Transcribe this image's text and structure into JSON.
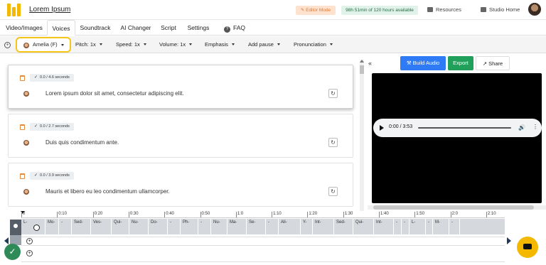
{
  "app": {
    "title": "Lorem Ipsum",
    "editor_mode": "Editor Mode",
    "time_available": "98h 51min of 120 hours available",
    "resources": "Resources",
    "studio_home": "Studio Home"
  },
  "tabs": [
    {
      "label": "Video/Images"
    },
    {
      "label": "Voices"
    },
    {
      "label": "Soundtrack"
    },
    {
      "label": "AI Changer"
    },
    {
      "label": "Script"
    },
    {
      "label": "Settings"
    },
    {
      "label": "FAQ"
    }
  ],
  "toolbar": {
    "voice": "Amelia (F)",
    "pitch": "Pitch: 1x",
    "speed": "Speed: 1x",
    "volume": "Volume: 1x",
    "emphasis": "Emphasis",
    "add_pause": "Add pause",
    "pronunciation": "Pronunciation"
  },
  "cards": [
    {
      "duration": "0.0 / 4.6 seconds",
      "text": "Lorem ipsum dolor sit amet, consectetur adipiscing elit."
    },
    {
      "duration": "0.0 / 2.7 seconds",
      "text": "Duis quis condimentum ante."
    },
    {
      "duration": "0.0 / 3.9 seconds",
      "text": "Mauris et libero eu leo condimentum ullamcorper."
    }
  ],
  "right": {
    "collapse": "«",
    "build_audio": "Build Audio",
    "export": "Export",
    "share": "Share",
    "audio_time": "0:00 / 3:53"
  },
  "timeline": {
    "ticks": [
      "0",
      "0:10",
      "0:20",
      "0:30",
      "0:40",
      "0:50",
      "1:0",
      "1:10",
      "1:20",
      "1:30",
      "1:40",
      "1:50",
      "2:0",
      "2:10"
    ],
    "segments": [
      "L-",
      "Mo-",
      "-",
      "Sed-",
      "Ves-",
      "Qui-",
      "Nu-",
      "Do-",
      "-",
      "Ph-",
      "-",
      "Nu-",
      "Ma-",
      "Se-",
      "-",
      "Ali-",
      "Y-",
      "Int-",
      "Sed-",
      "Qui-",
      "Int-",
      "-",
      "-",
      "L-",
      "-",
      "M-",
      "-"
    ]
  },
  "colors": {
    "accent_yellow": "#f5b800",
    "build_blue": "#2f7bf5",
    "export_green": "#20a05a"
  }
}
